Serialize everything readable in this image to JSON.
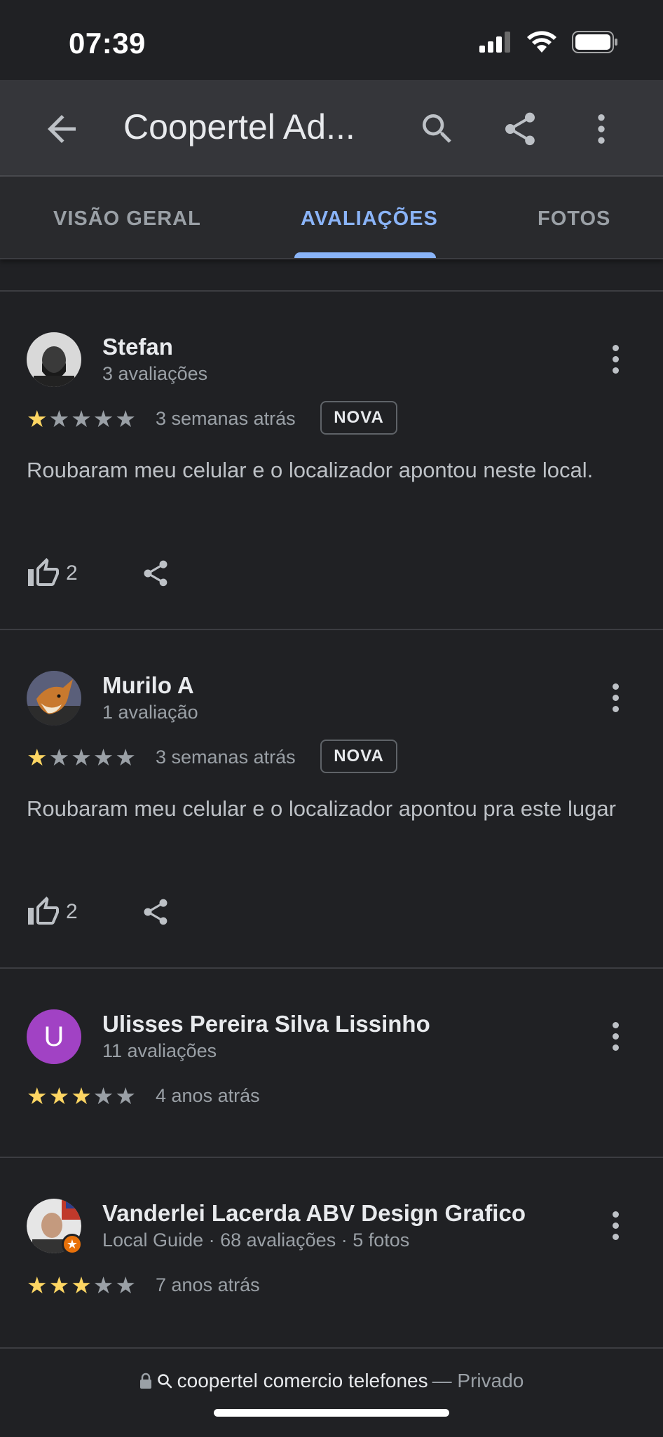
{
  "status": {
    "time": "07:39"
  },
  "app_bar": {
    "title": "Coopertel Ad..."
  },
  "tabs": [
    {
      "label": "VISÃO GERAL",
      "active": false
    },
    {
      "label": "AVALIAÇÕES",
      "active": true
    },
    {
      "label": "FOTOS",
      "active": false
    }
  ],
  "colors": {
    "star_filled": "#fdd663",
    "star_empty": "#9aa0a6",
    "accent": "#8ab4f8",
    "background": "#202124"
  },
  "reviews": [
    {
      "name": "Stefan",
      "meta": "3 avaliações",
      "rating": 1,
      "time": "3 semanas atrás",
      "badge": "NOVA",
      "text": "Roubaram meu celular e o localizador apontou neste local.",
      "likes": "2",
      "avatar": "photo"
    },
    {
      "name": "Murilo A",
      "meta": "1 avaliação",
      "rating": 1,
      "time": "3 semanas atrás",
      "badge": "NOVA",
      "text": "Roubaram meu celular e o localizador apontou pra este lugar",
      "likes": "2",
      "avatar": "fox-photo"
    },
    {
      "name": "Ulisses Pereira Silva Lissinho",
      "meta": "11 avaliações",
      "rating": 3,
      "time": "4 anos atrás",
      "avatar_letter": "U",
      "avatar_color": "#a142c4"
    },
    {
      "name": "Vanderlei Lacerda ABV Design Grafico",
      "meta": "Local Guide · 68 avaliações · 5 fotos",
      "rating": 3,
      "time": "7 anos atrás",
      "avatar": "photo-local-guide"
    }
  ],
  "bottom_bar": {
    "query": "coopertel comercio telefones",
    "private_label": "— Privado"
  }
}
